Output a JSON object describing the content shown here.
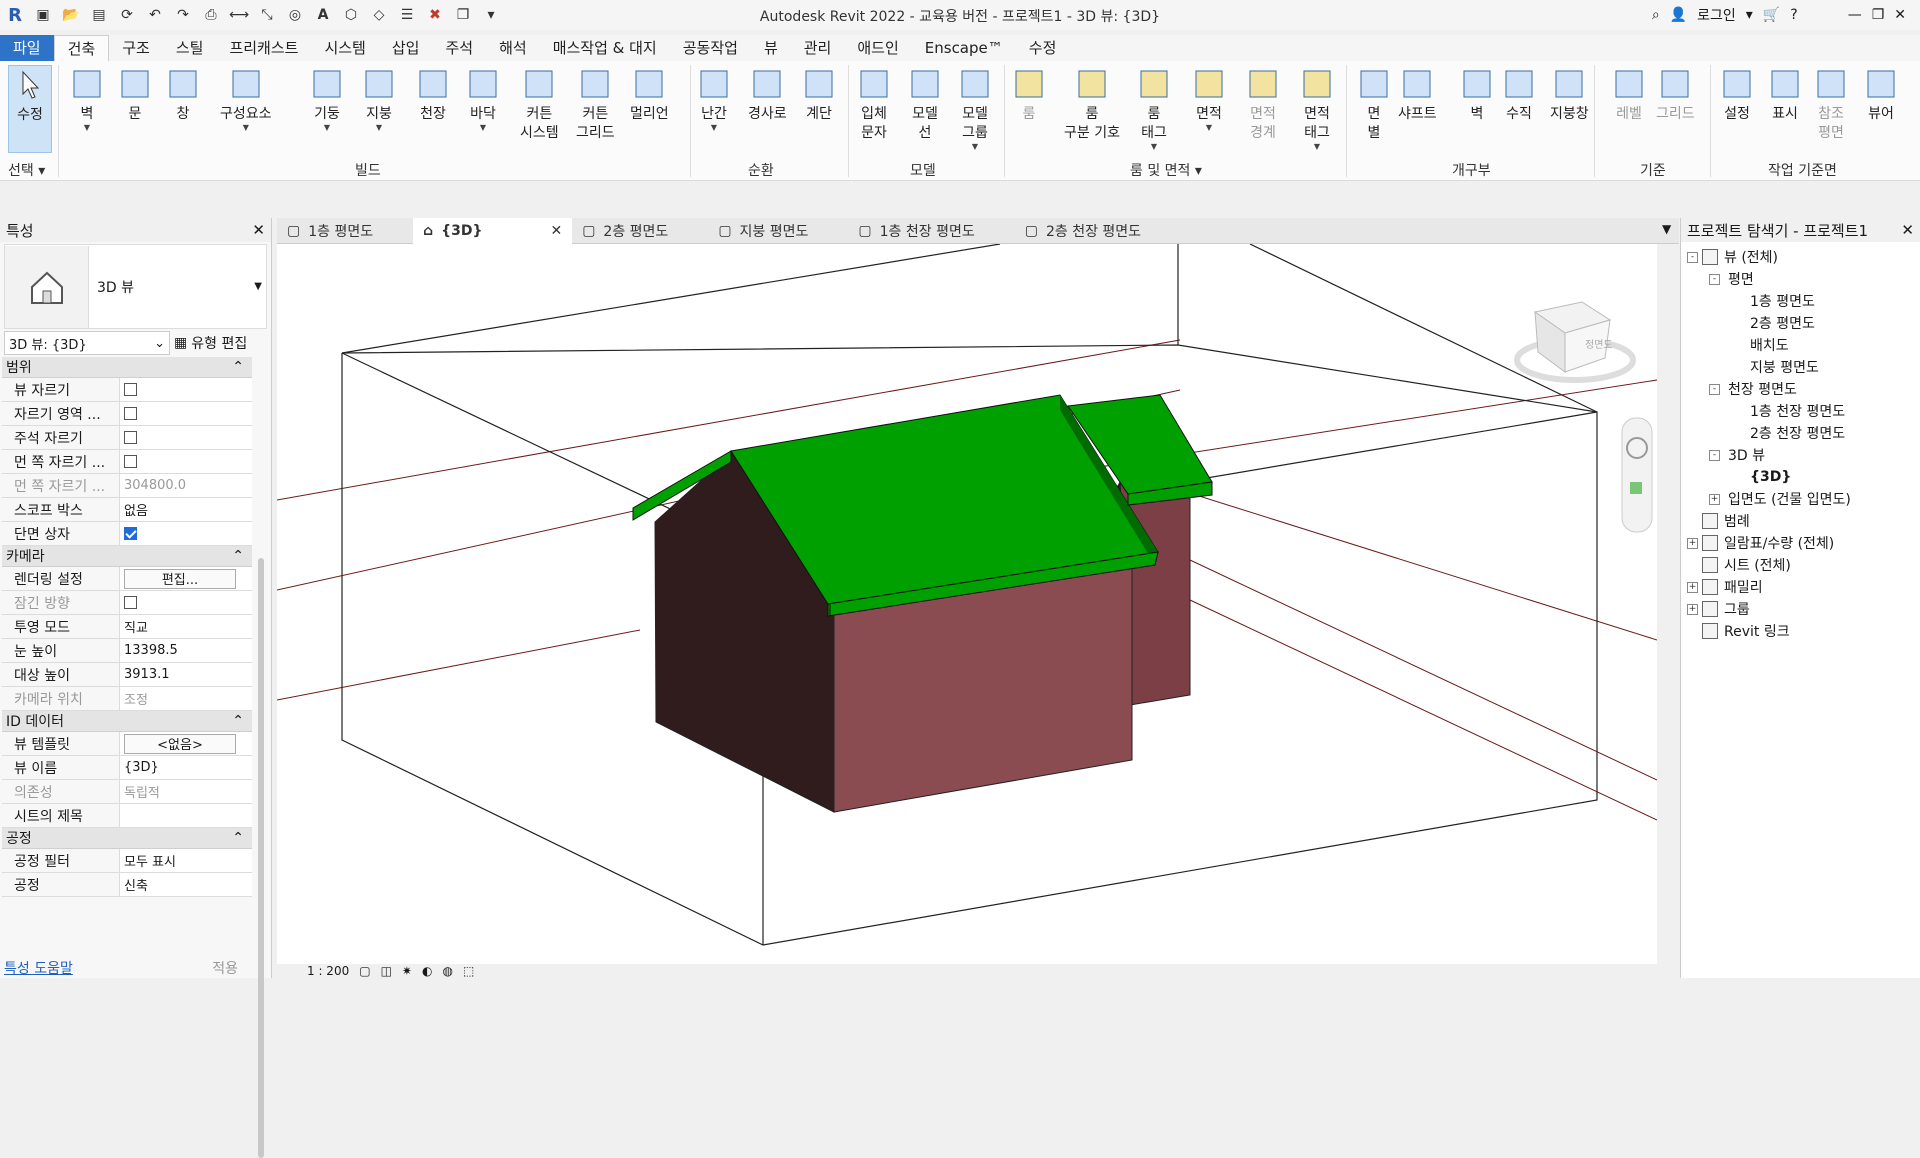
{
  "title": "Autodesk Revit 2022 - 교육용 버전 - 프로젝트1 - 3D 뷰: {3D}",
  "titlebar": {
    "login": "로그인"
  },
  "ribbon_tabs": [
    "파일",
    "건축",
    "구조",
    "스틸",
    "프리캐스트",
    "시스템",
    "삽입",
    "주석",
    "해석",
    "매스작업 & 대지",
    "공동작업",
    "뷰",
    "관리",
    "애드인",
    "Enscape™",
    "수정"
  ],
  "ribbon": {
    "select_button": "수정",
    "select_panel": "선택",
    "build": [
      "벽",
      "문",
      "창",
      "구성요소",
      "기둥",
      "지붕",
      "천장",
      "바닥",
      "커튼\n시스템",
      "커튼\n그리드",
      "멀리언"
    ],
    "build_panel": "빌드",
    "circulation": [
      "난간",
      "경사로",
      "계단"
    ],
    "circulation_panel": "순환",
    "model": [
      "입체\n문자",
      "모델\n선",
      "모델\n그룹"
    ],
    "model_panel": "모델",
    "room": [
      "룸",
      "룸\n구분 기호",
      "룸\n태그",
      "면적",
      "면적\n경계",
      "면적\n태그"
    ],
    "room_panel": "룸 및 면적",
    "opening": [
      "면\n별",
      "샤프트",
      "벽",
      "수직",
      "지붕창"
    ],
    "opening_panel": "개구부",
    "datum": [
      "레벨",
      "그리드"
    ],
    "datum_panel": "기준",
    "workplane": [
      "설정",
      "표시",
      "참조\n평면",
      "뷰어"
    ],
    "workplane_panel": "작업 기준면"
  },
  "properties": {
    "header": "특성",
    "type_name": "3D 뷰",
    "view_select": "3D 뷰: {3D}",
    "edit_type": "유형 편집",
    "categories": [
      {
        "name": "범위",
        "rows": [
          {
            "k": "뷰 자르기",
            "type": "check",
            "checked": false
          },
          {
            "k": "자르기 영역 ...",
            "type": "check",
            "checked": false
          },
          {
            "k": "주석 자르기",
            "type": "check",
            "checked": false
          },
          {
            "k": "먼 쪽 자르기 ...",
            "type": "check",
            "checked": false
          },
          {
            "k": "먼 쪽 자르기 ...",
            "type": "text",
            "v": "304800.0",
            "disabled": true
          },
          {
            "k": "스코프 박스",
            "type": "text",
            "v": "없음"
          },
          {
            "k": "단면 상자",
            "type": "check",
            "checked": true
          }
        ]
      },
      {
        "name": "카메라",
        "rows": [
          {
            "k": "렌더링 설정",
            "type": "button",
            "v": "편집..."
          },
          {
            "k": "잠긴 방향",
            "type": "check",
            "checked": false,
            "disabled": true
          },
          {
            "k": "투영 모드",
            "type": "text",
            "v": "직교"
          },
          {
            "k": "눈 높이",
            "type": "text",
            "v": "13398.5"
          },
          {
            "k": "대상 높이",
            "type": "text",
            "v": "3913.1"
          },
          {
            "k": "카메라 위치",
            "type": "text",
            "v": "조정",
            "disabled": true
          }
        ]
      },
      {
        "name": "ID 데이터",
        "rows": [
          {
            "k": "뷰 템플릿",
            "type": "button",
            "v": "<없음>"
          },
          {
            "k": "뷰 이름",
            "type": "text",
            "v": "{3D}"
          },
          {
            "k": "의존성",
            "type": "text",
            "v": "독립적",
            "disabled": true
          },
          {
            "k": "시트의 제목",
            "type": "text",
            "v": ""
          }
        ]
      },
      {
        "name": "공정",
        "rows": [
          {
            "k": "공정 필터",
            "type": "text",
            "v": "모두 표시"
          },
          {
            "k": "공정",
            "type": "text",
            "v": "신축"
          }
        ]
      }
    ],
    "help_link": "특성 도움말",
    "apply": "적용"
  },
  "view_tabs": [
    {
      "label": "1층 평면도",
      "active": false
    },
    {
      "label": "{3D}",
      "active": true
    },
    {
      "label": "2층 평면도",
      "active": false
    },
    {
      "label": "지붕 평면도",
      "active": false
    },
    {
      "label": "1층 천장 평면도",
      "active": false
    },
    {
      "label": "2층 천장 평면도",
      "active": false
    }
  ],
  "viewcube_label": "정면도",
  "scale": "1 : 200",
  "browser": {
    "header": "프로젝트 탐색기 - 프로젝트1",
    "tree": [
      {
        "label": "뷰 (전체)",
        "level": 0,
        "exp": "-"
      },
      {
        "label": "평면",
        "level": 1,
        "exp": "-"
      },
      {
        "label": "1층 평면도",
        "level": 2
      },
      {
        "label": "2층 평면도",
        "level": 2
      },
      {
        "label": "배치도",
        "level": 2
      },
      {
        "label": "지붕 평면도",
        "level": 2
      },
      {
        "label": "천장 평면도",
        "level": 1,
        "exp": "-"
      },
      {
        "label": "1층 천장 평면도",
        "level": 2
      },
      {
        "label": "2층 천장 평면도",
        "level": 2
      },
      {
        "label": "3D 뷰",
        "level": 1,
        "exp": "-"
      },
      {
        "label": "{3D}",
        "level": 2,
        "bold": true
      },
      {
        "label": "입면도 (건물 입면도)",
        "level": 1,
        "exp": "+"
      },
      {
        "label": "범례",
        "level": 0
      },
      {
        "label": "일람표/수량 (전체)",
        "level": 0,
        "exp": "+"
      },
      {
        "label": "시트 (전체)",
        "level": 0
      },
      {
        "label": "패밀리",
        "level": 0,
        "exp": "+"
      },
      {
        "label": "그룹",
        "level": 0,
        "exp": "+"
      },
      {
        "label": "Revit 링크",
        "level": 0
      }
    ]
  },
  "colors": {
    "file_tab": "#2d73c7",
    "roof": "#00a000",
    "wall_front": "#8a4b51",
    "wall_side": "#301b1d"
  }
}
